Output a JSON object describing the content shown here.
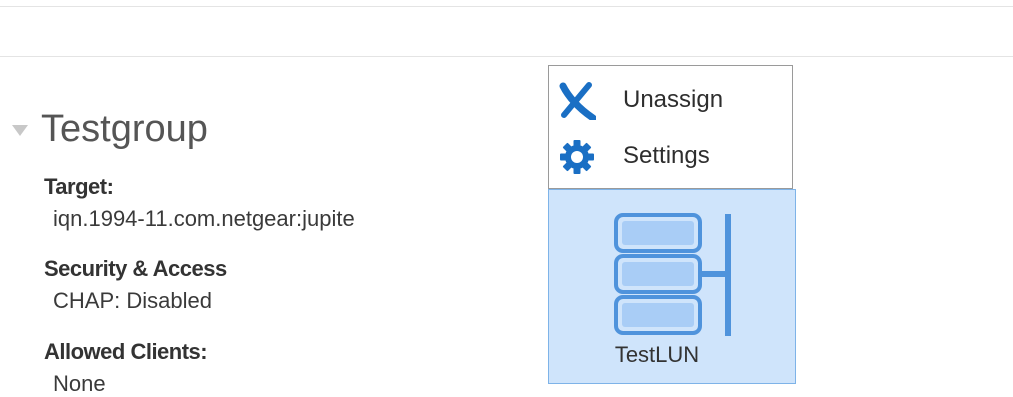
{
  "group": {
    "title": "Testgroup",
    "target_label": "Target:",
    "target_value": "iqn.1994-11.com.netgear:jupite",
    "security_label": "Security & Access",
    "security_value": "CHAP: Disabled",
    "clients_label": "Allowed Clients:",
    "clients_value": "None"
  },
  "context_menu": {
    "items": [
      {
        "label": "Unassign",
        "icon": "unassign-x-icon"
      },
      {
        "label": "Settings",
        "icon": "gear-icon"
      }
    ]
  },
  "lun": {
    "name": "TestLUN",
    "icon": "lun-storage-icon"
  },
  "colors": {
    "accent_blue": "#1a6fc4",
    "tile_fill": "#cfe4fb",
    "tile_border": "#7eb3e8",
    "disk_fill": "#a9cdf6",
    "disk_stroke": "#4f93dc"
  }
}
